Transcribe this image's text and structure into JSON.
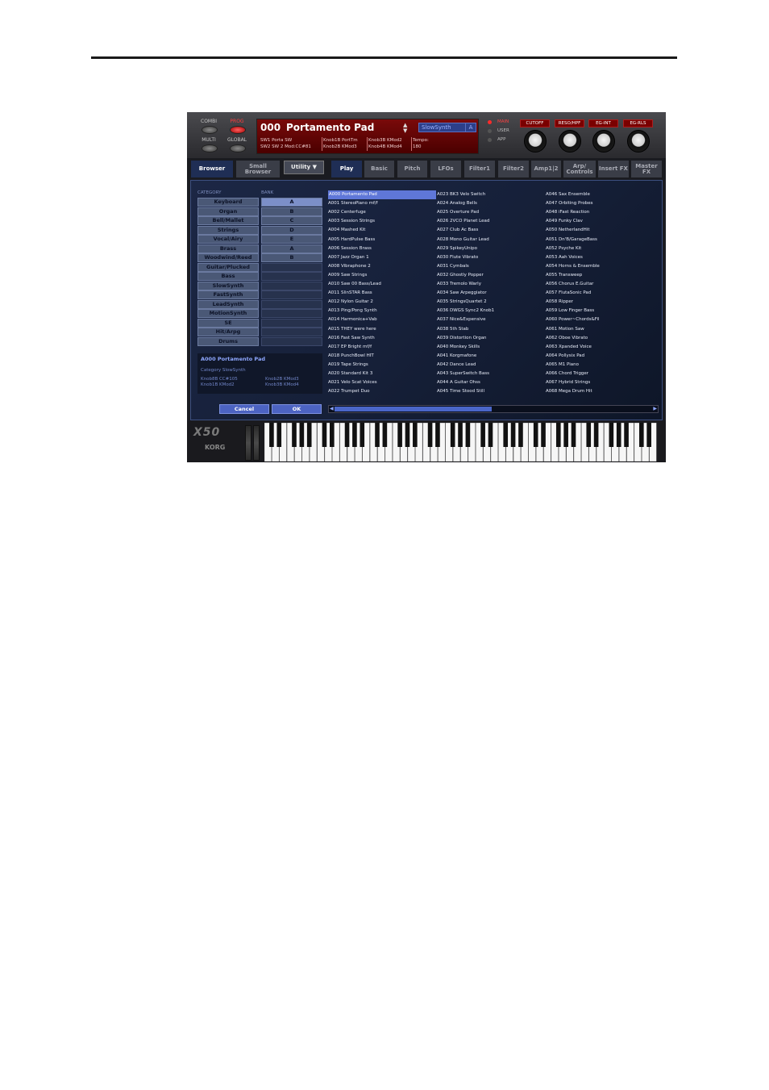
{
  "header": {
    "modes": [
      {
        "label": "COMBI",
        "active": false
      },
      {
        "label": "PROG",
        "active": true
      },
      {
        "label": "MULTI",
        "active": false
      },
      {
        "label": "GLOBAL",
        "active": false
      }
    ],
    "program_number": "000",
    "program_name": "Portamento Pad",
    "category": "SlowSynth",
    "bank": "A",
    "lcd_sub": {
      "col1_line1": "SW1  Porta SW",
      "col1_line2": "SW2 SW 2 Mod:CC#81",
      "col2_line1": "Knob1B  PortTm",
      "col2_line2": "Knob2B  KMod3",
      "col3_line1": "Knob3B  KMod2",
      "col3_line2": "Knob4B  KMod4",
      "col4_line1": "Tempo:",
      "col4_line2": "180"
    },
    "leds": [
      {
        "label": "MAIN",
        "on": true
      },
      {
        "label": "USER",
        "on": false
      },
      {
        "label": "APP",
        "on": false
      }
    ],
    "knobs": [
      "CUTOFF",
      "RESO/HPF",
      "EG-INT",
      "EG-RLS"
    ]
  },
  "tabs": {
    "browser": "Browser",
    "small_browser": "Small Browser",
    "utility": "Utility ▼",
    "items": [
      "Play",
      "Basic",
      "Pitch",
      "LFOs",
      "Filter1",
      "Filter2",
      "Amp1|2",
      "Arp/ Controls",
      "Insert FX",
      "Master FX"
    ]
  },
  "browser": {
    "category_header": "CATEGORY",
    "bank_header": "BANK",
    "categories": [
      "Keyboard",
      "Organ",
      "Bell/Mallet",
      "Strings",
      "Vocal/Airy",
      "Brass",
      "Woodwind/Reed",
      "Guitar/Plucked",
      "Bass",
      "SlowSynth",
      "FastSynth",
      "LeadSynth",
      "MotionSynth",
      "SE",
      "Hit/Arpg",
      "Drums"
    ],
    "banks": [
      "A",
      "B",
      "C",
      "D",
      "E",
      "A",
      "B",
      "",
      "",
      "",
      "",
      "",
      "",
      "",
      "",
      ""
    ],
    "selected_bank_index": 0,
    "info": {
      "name": "A000 Portamento Pad",
      "category": "Category SlowSynth",
      "k1": "Knob8B CC#105",
      "k2": "Knob1B KMod2",
      "k3": "Knob2B KMod3",
      "k4": "Knob3B KMod4"
    },
    "programs_col1": [
      "A000 Portamento Pad",
      "A001 StereoPiano mf/f",
      "A002 Centerfuge",
      "A003 Session Strings",
      "A004 Mashed Kit",
      "A005 HardPulse Bass",
      "A006 Session Brass",
      "A007 Jazz Organ 1",
      "A008 Vibraphone 2",
      "A009 Saw Strings",
      "A010 Saw 00 Bass/Lead",
      "A011 SlinSTAR Bass",
      "A012 Nylon Guitar 2",
      "A013 Ping/Pong Synth",
      "A014 Harmonica+Vab",
      "A015 THEY were here",
      "A016 Fast Saw Synth",
      "A017 EP Bright mf/f",
      "A018 PunchBowl HIT",
      "A019 Tape Strings",
      "A020 Standard Kit 3",
      "A021 Velo Scat Voices",
      "A022 Trumpet Duo"
    ],
    "programs_col2": [
      "A023 BK3 Velo Switch",
      "A024 Analog Bells",
      "A025 Overture Pad",
      "A026 2VCO Planet Lead",
      "A027 Club Ac Bass",
      "A028 Mono Guitar Lead",
      "A029 SpikeyUnipo",
      "A030 Flute Vibrato",
      "A031 Cymbals",
      "A032 Ghostly Popper",
      "A033 Tremolo Warly",
      "A034 Saw Arpeggiator",
      "A035 StringsQuartet 2",
      "A036 DWGS Sync2 Knob1",
      "A037 Nice&Expensive",
      "A038 5th Stab",
      "A039 Distortion Organ",
      "A040 Monkey Skills",
      "A041 Korgmafone",
      "A042 Dance Lead",
      "A043 SuperSwitch Bass",
      "A044 A Guitar Ohss",
      "A045 Time Stood Still"
    ],
    "programs_col3": [
      "A046 Sax Ensemble",
      "A047 Orbiting Probes",
      "A048 iFast Reaction",
      "A049 Funky Clav",
      "A050 NetherlandHit",
      "A051 Dn'B/GarageBass",
      "A052 Psyche Kit",
      "A053 Aah Voices",
      "A054 Horns & Ensemble",
      "A055 Transweep",
      "A056 Chorus E.Guitar",
      "A057 FlutaSonic Pad",
      "A058 Ripper",
      "A059 Low Finger Bass",
      "A060 Power~Chords&Fil",
      "A061 Motion Saw",
      "A062 Oboe Vibrato",
      "A063 Xpanded Voice",
      "A064 Pollysix Pad",
      "A065 M1 Piano",
      "A066 Chord Trigger",
      "A067 Hybrid Strings",
      "A068 Mega Drum Hit"
    ],
    "cancel": "Cancel",
    "ok": "OK"
  },
  "footer": {
    "logo_model": "X50",
    "logo_brand": "KORG"
  },
  "colors": {
    "accent": "#5f77d8",
    "panel": "#162039",
    "lcd": "#7a0a0a"
  }
}
